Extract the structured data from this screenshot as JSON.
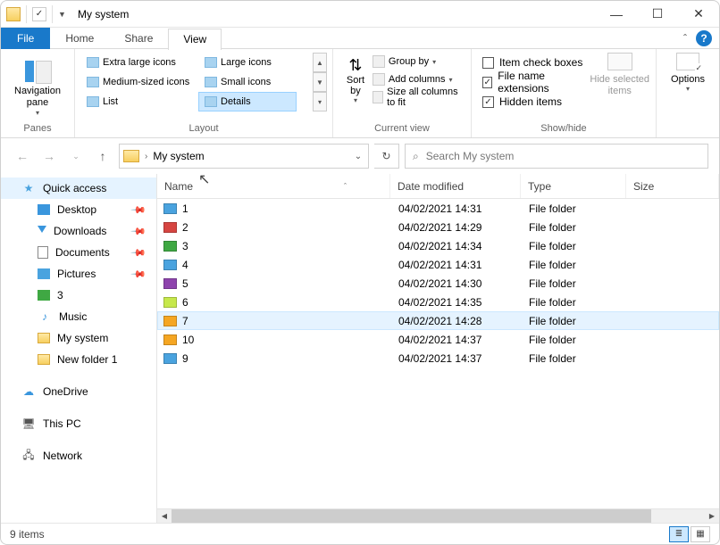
{
  "window": {
    "title": "My system",
    "min": "—",
    "max": "☐",
    "close": "✕",
    "collapse": "ˆ",
    "help": "?"
  },
  "tabs": {
    "file": "File",
    "home": "Home",
    "share": "Share",
    "view": "View"
  },
  "ribbon": {
    "panes": {
      "navpane": "Navigation pane",
      "drop": "▾",
      "label": "Panes"
    },
    "layout": {
      "extra": "Extra large icons",
      "large": "Large icons",
      "medium": "Medium-sized icons",
      "small": "Small icons",
      "list": "List",
      "details": "Details",
      "label": "Layout"
    },
    "currentview": {
      "sort": "Sort by",
      "group": "Group by",
      "addcols": "Add columns",
      "sizecols": "Size all columns to fit",
      "label": "Current view",
      "drop": "▾"
    },
    "showhide": {
      "itemcheck": "Item check boxes",
      "ext": "File name extensions",
      "hidden": "Hidden items",
      "hidebtn": "Hide selected items",
      "label": "Show/hide"
    },
    "options": {
      "label": "Options",
      "drop": "▾"
    }
  },
  "addr": {
    "path": "My system",
    "chev": "›",
    "drop": "⌄",
    "refresh": "↻",
    "up": "↑",
    "back": "←",
    "fwd": "→"
  },
  "search": {
    "placeholder": "Search My system",
    "icon": "⌕"
  },
  "sidebar": {
    "quick": "Quick access",
    "desktop": "Desktop",
    "downloads": "Downloads",
    "documents": "Documents",
    "pictures": "Pictures",
    "three": "3",
    "music": "Music",
    "mysystem": "My system",
    "newfolder": "New folder 1",
    "onedrive": "OneDrive",
    "thispc": "This PC",
    "network": "Network"
  },
  "columns": {
    "name": "Name",
    "date": "Date modified",
    "type": "Type",
    "size": "Size",
    "sort": "ˆ"
  },
  "rows": [
    {
      "name": "1",
      "date": "04/02/2021 14:31",
      "type": "File folder",
      "color": "#4aa3df"
    },
    {
      "name": "2",
      "date": "04/02/2021 14:29",
      "type": "File folder",
      "color": "#d64541"
    },
    {
      "name": "3",
      "date": "04/02/2021 14:34",
      "type": "File folder",
      "color": "#3fa843"
    },
    {
      "name": "4",
      "date": "04/02/2021 14:31",
      "type": "File folder",
      "color": "#4aa3df"
    },
    {
      "name": "5",
      "date": "04/02/2021 14:30",
      "type": "File folder",
      "color": "#8e44ad"
    },
    {
      "name": "6",
      "date": "04/02/2021 14:35",
      "type": "File folder",
      "color": "#c6e84b"
    },
    {
      "name": "7",
      "date": "04/02/2021 14:28",
      "type": "File folder",
      "color": "#f5a623",
      "hover": true
    },
    {
      "name": "10",
      "date": "04/02/2021 14:37",
      "type": "File folder",
      "color": "#f5a623"
    },
    {
      "name": "9",
      "date": "04/02/2021 14:37",
      "type": "File folder",
      "color": "#4aa3df"
    }
  ],
  "status": {
    "count": "9 items"
  }
}
